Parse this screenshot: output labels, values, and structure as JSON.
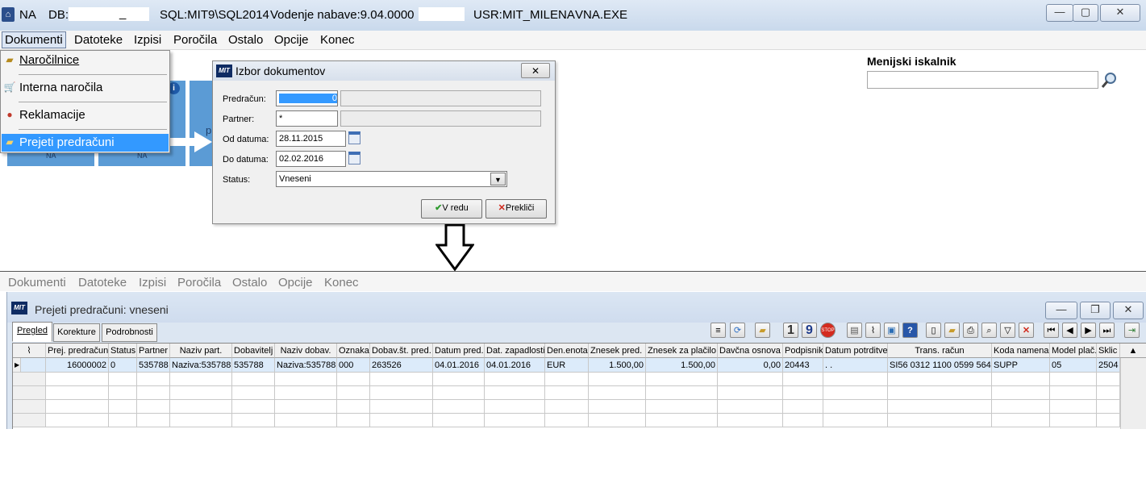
{
  "titlebar": {
    "app": "NA",
    "db_label": "DB:",
    "db_sep": "_",
    "sql": "SQL:MIT9\\SQL2014",
    "module": "Vodenje nabave:9.04.0000",
    "user": "USR:MIT_MILENA",
    "exe": "VNA.EXE",
    "min": "—",
    "max": "▢",
    "close": "✕"
  },
  "menu": [
    "Dokumenti",
    "Datoteke",
    "Izpisi",
    "Poročila",
    "Ostalo",
    "Opcije",
    "Konec"
  ],
  "dropdown": {
    "items": [
      {
        "label": "Naročilnice",
        "icon": "folder-open-icon"
      },
      {
        "label": "Interna naročila",
        "icon": "cart-icon"
      },
      {
        "label": "Reklamacije",
        "icon": "complaint-icon"
      },
      {
        "label": "Prejeti predračuni",
        "icon": "folder-open-icon"
      }
    ]
  },
  "tiles": {
    "tile1": "NA",
    "tile2": "NA",
    "info": "i",
    "partial": "p"
  },
  "search": {
    "label": "Menijski iskalnik",
    "value": ""
  },
  "dialog": {
    "title": "Izbor dokumentov",
    "logo": "MIT",
    "close": "✕",
    "fields": {
      "predracun_label": "Predračun:",
      "predracun_value": "0",
      "partner_label": "Partner:",
      "partner_value": "*",
      "od_label": "Od datuma:",
      "od_value": "28.11.2015",
      "do_label": "Do datuma:",
      "do_value": "02.02.2016",
      "status_label": "Status:",
      "status_value": "Vneseni"
    },
    "ok": "V redu",
    "cancel": "Prekliči"
  },
  "lower_menu": [
    "Dokumenti",
    "Datoteke",
    "Izpisi",
    "Poročila",
    "Ostalo",
    "Opcije",
    "Konec"
  ],
  "window2": {
    "logo": "MIT",
    "title": "Prejeti predračuni: vneseni",
    "tabs": [
      "Pregled",
      "Korekture",
      "Podrobnosti"
    ],
    "toolbar_nums": [
      "1",
      "9"
    ]
  },
  "grid": {
    "columns": [
      "Prej. predračun",
      "Status",
      "Partner",
      "Naziv part.",
      "Dobavitelj",
      "Naziv dobav.",
      "Oznaka",
      "Dobav.št. pred.",
      "Datum pred.",
      "Dat. zapadlosti",
      "Den.enota",
      "Znesek pred.",
      "Znesek za plačilo",
      "Davčna osnova",
      "Podpisnik",
      "Datum potrditve",
      "Trans. račun",
      "Koda namena",
      "Model plač.",
      "Sklic"
    ],
    "rows": [
      [
        "16000002",
        "0",
        "535788",
        "Naziva:535788",
        "535788",
        "Naziva:535788",
        "000",
        "263526",
        "04.01.2016",
        "04.01.2016",
        "EUR",
        "1.500,00",
        "1.500,00",
        "0,00",
        "20443",
        ". .",
        "SI56 0312 1100 0599 564",
        "SUPP",
        "05",
        "2504"
      ]
    ]
  }
}
